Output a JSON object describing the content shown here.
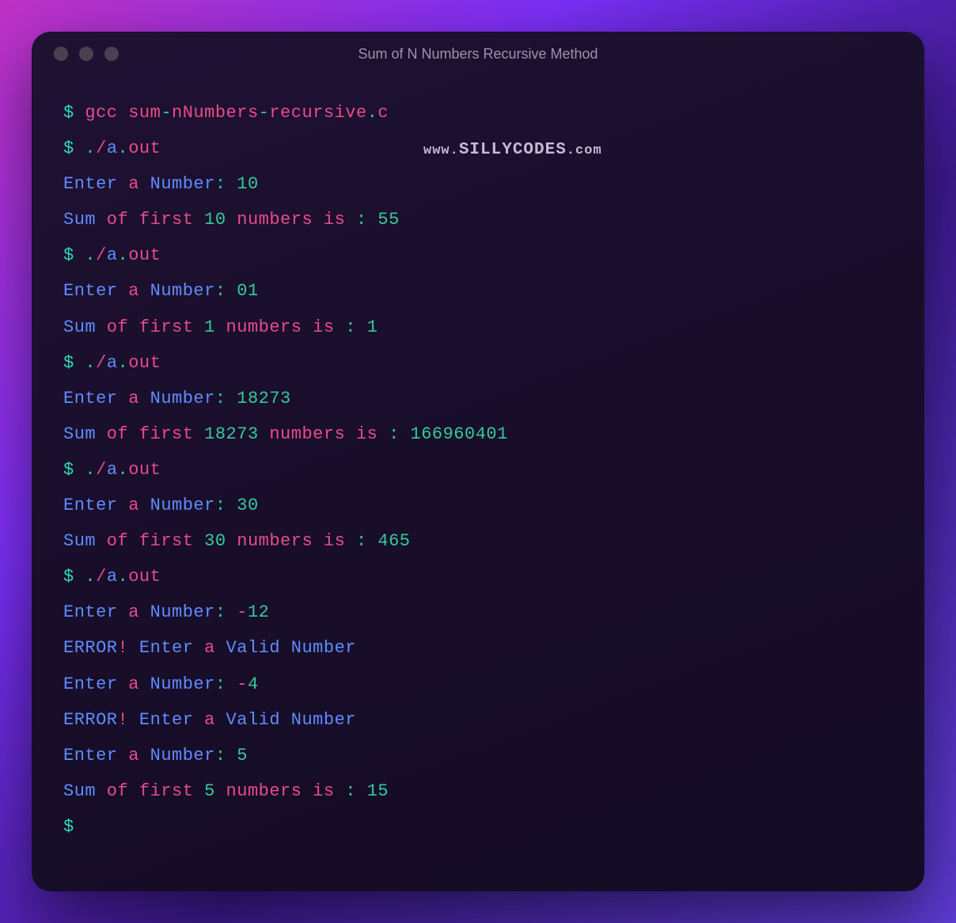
{
  "window": {
    "title": "Sum of N Numbers Recursive Method"
  },
  "watermark": {
    "prefix": "www.",
    "main": "SILLYCODES",
    "suffix": ".com"
  },
  "colors": {
    "prompt": "#2fd8b6",
    "cmd": "#e94b8a",
    "keyword": "#5f8cff",
    "string": "#35c99b"
  },
  "lines": [
    [
      {
        "t": "$ ",
        "c": "tok-prompt"
      },
      {
        "t": "gcc sum",
        "c": "tok-cmd"
      },
      {
        "t": "-",
        "c": "tok-op2"
      },
      {
        "t": "nNumbers",
        "c": "tok-cmd"
      },
      {
        "t": "-",
        "c": "tok-op2"
      },
      {
        "t": "recursive",
        "c": "tok-cmd"
      },
      {
        "t": ".",
        "c": "tok-op2"
      },
      {
        "t": "c",
        "c": "tok-cmd"
      }
    ],
    [
      {
        "t": "$ ",
        "c": "tok-prompt"
      },
      {
        "t": ".",
        "c": "tok-op2"
      },
      {
        "t": "/",
        "c": "tok-op"
      },
      {
        "t": "a",
        "c": "tok-keyword"
      },
      {
        "t": ".",
        "c": "tok-op2"
      },
      {
        "t": "out",
        "c": "tok-cmd"
      }
    ],
    [
      {
        "t": "Enter",
        "c": "tok-keyword"
      },
      {
        "t": " a ",
        "c": "tok-ident"
      },
      {
        "t": "Number",
        "c": "tok-keyword"
      },
      {
        "t": ": ",
        "c": "tok-op2"
      },
      {
        "t": "10",
        "c": "tok-str"
      }
    ],
    [
      {
        "t": "Sum",
        "c": "tok-keyword"
      },
      {
        "t": " of first ",
        "c": "tok-ident"
      },
      {
        "t": "10",
        "c": "tok-str"
      },
      {
        "t": " numbers is ",
        "c": "tok-ident"
      },
      {
        "t": ":",
        "c": "tok-op2"
      },
      {
        "t": " ",
        "c": ""
      },
      {
        "t": "55",
        "c": "tok-str"
      }
    ],
    [
      {
        "t": "$ ",
        "c": "tok-prompt"
      },
      {
        "t": ".",
        "c": "tok-op2"
      },
      {
        "t": "/",
        "c": "tok-op"
      },
      {
        "t": "a",
        "c": "tok-keyword"
      },
      {
        "t": ".",
        "c": "tok-op2"
      },
      {
        "t": "out",
        "c": "tok-cmd"
      }
    ],
    [
      {
        "t": "Enter",
        "c": "tok-keyword"
      },
      {
        "t": " a ",
        "c": "tok-ident"
      },
      {
        "t": "Number",
        "c": "tok-keyword"
      },
      {
        "t": ": ",
        "c": "tok-op2"
      },
      {
        "t": "01",
        "c": "tok-str"
      }
    ],
    [
      {
        "t": "Sum",
        "c": "tok-keyword"
      },
      {
        "t": " of first ",
        "c": "tok-ident"
      },
      {
        "t": "1",
        "c": "tok-str"
      },
      {
        "t": " numbers is ",
        "c": "tok-ident"
      },
      {
        "t": ":",
        "c": "tok-op2"
      },
      {
        "t": " ",
        "c": ""
      },
      {
        "t": "1",
        "c": "tok-str"
      }
    ],
    [
      {
        "t": "$ ",
        "c": "tok-prompt"
      },
      {
        "t": ".",
        "c": "tok-op2"
      },
      {
        "t": "/",
        "c": "tok-op"
      },
      {
        "t": "a",
        "c": "tok-keyword"
      },
      {
        "t": ".",
        "c": "tok-op2"
      },
      {
        "t": "out",
        "c": "tok-cmd"
      }
    ],
    [
      {
        "t": "Enter",
        "c": "tok-keyword"
      },
      {
        "t": " a ",
        "c": "tok-ident"
      },
      {
        "t": "Number",
        "c": "tok-keyword"
      },
      {
        "t": ": ",
        "c": "tok-op2"
      },
      {
        "t": "18273",
        "c": "tok-str"
      }
    ],
    [
      {
        "t": "Sum",
        "c": "tok-keyword"
      },
      {
        "t": " of first ",
        "c": "tok-ident"
      },
      {
        "t": "18273",
        "c": "tok-str"
      },
      {
        "t": " numbers is ",
        "c": "tok-ident"
      },
      {
        "t": ":",
        "c": "tok-op2"
      },
      {
        "t": " ",
        "c": ""
      },
      {
        "t": "166960401",
        "c": "tok-str"
      }
    ],
    [
      {
        "t": "$ ",
        "c": "tok-prompt"
      },
      {
        "t": ".",
        "c": "tok-op2"
      },
      {
        "t": "/",
        "c": "tok-op"
      },
      {
        "t": "a",
        "c": "tok-keyword"
      },
      {
        "t": ".",
        "c": "tok-op2"
      },
      {
        "t": "out",
        "c": "tok-cmd"
      }
    ],
    [
      {
        "t": "Enter",
        "c": "tok-keyword"
      },
      {
        "t": " a ",
        "c": "tok-ident"
      },
      {
        "t": "Number",
        "c": "tok-keyword"
      },
      {
        "t": ": ",
        "c": "tok-op2"
      },
      {
        "t": "30",
        "c": "tok-str"
      }
    ],
    [
      {
        "t": "Sum",
        "c": "tok-keyword"
      },
      {
        "t": " of first ",
        "c": "tok-ident"
      },
      {
        "t": "30",
        "c": "tok-str"
      },
      {
        "t": " numbers is ",
        "c": "tok-ident"
      },
      {
        "t": ":",
        "c": "tok-op2"
      },
      {
        "t": " ",
        "c": ""
      },
      {
        "t": "465",
        "c": "tok-str"
      }
    ],
    [
      {
        "t": "$ ",
        "c": "tok-prompt"
      },
      {
        "t": ".",
        "c": "tok-op2"
      },
      {
        "t": "/",
        "c": "tok-op"
      },
      {
        "t": "a",
        "c": "tok-keyword"
      },
      {
        "t": ".",
        "c": "tok-op2"
      },
      {
        "t": "out",
        "c": "tok-cmd"
      }
    ],
    [
      {
        "t": "Enter",
        "c": "tok-keyword"
      },
      {
        "t": " a ",
        "c": "tok-ident"
      },
      {
        "t": "Number",
        "c": "tok-keyword"
      },
      {
        "t": ": ",
        "c": "tok-op2"
      },
      {
        "t": "-",
        "c": "tok-op"
      },
      {
        "t": "12",
        "c": "tok-str"
      }
    ],
    [
      {
        "t": "ERROR",
        "c": "tok-keyword"
      },
      {
        "t": "!",
        "c": "tok-op"
      },
      {
        "t": " Enter",
        "c": "tok-keyword"
      },
      {
        "t": " a ",
        "c": "tok-ident"
      },
      {
        "t": "Valid Number",
        "c": "tok-keyword"
      }
    ],
    [
      {
        "t": "Enter",
        "c": "tok-keyword"
      },
      {
        "t": " a ",
        "c": "tok-ident"
      },
      {
        "t": "Number",
        "c": "tok-keyword"
      },
      {
        "t": ": ",
        "c": "tok-op2"
      },
      {
        "t": "-",
        "c": "tok-op"
      },
      {
        "t": "4",
        "c": "tok-str"
      }
    ],
    [
      {
        "t": "ERROR",
        "c": "tok-keyword"
      },
      {
        "t": "!",
        "c": "tok-op"
      },
      {
        "t": " Enter",
        "c": "tok-keyword"
      },
      {
        "t": " a ",
        "c": "tok-ident"
      },
      {
        "t": "Valid Number",
        "c": "tok-keyword"
      }
    ],
    [
      {
        "t": "Enter",
        "c": "tok-keyword"
      },
      {
        "t": " a ",
        "c": "tok-ident"
      },
      {
        "t": "Number",
        "c": "tok-keyword"
      },
      {
        "t": ": ",
        "c": "tok-op2"
      },
      {
        "t": "5",
        "c": "tok-str"
      }
    ],
    [
      {
        "t": "Sum",
        "c": "tok-keyword"
      },
      {
        "t": " of first ",
        "c": "tok-ident"
      },
      {
        "t": "5",
        "c": "tok-str"
      },
      {
        "t": " numbers is ",
        "c": "tok-ident"
      },
      {
        "t": ":",
        "c": "tok-op2"
      },
      {
        "t": " ",
        "c": ""
      },
      {
        "t": "15",
        "c": "tok-str"
      }
    ],
    [
      {
        "t": "$ ",
        "c": "tok-prompt"
      }
    ]
  ]
}
